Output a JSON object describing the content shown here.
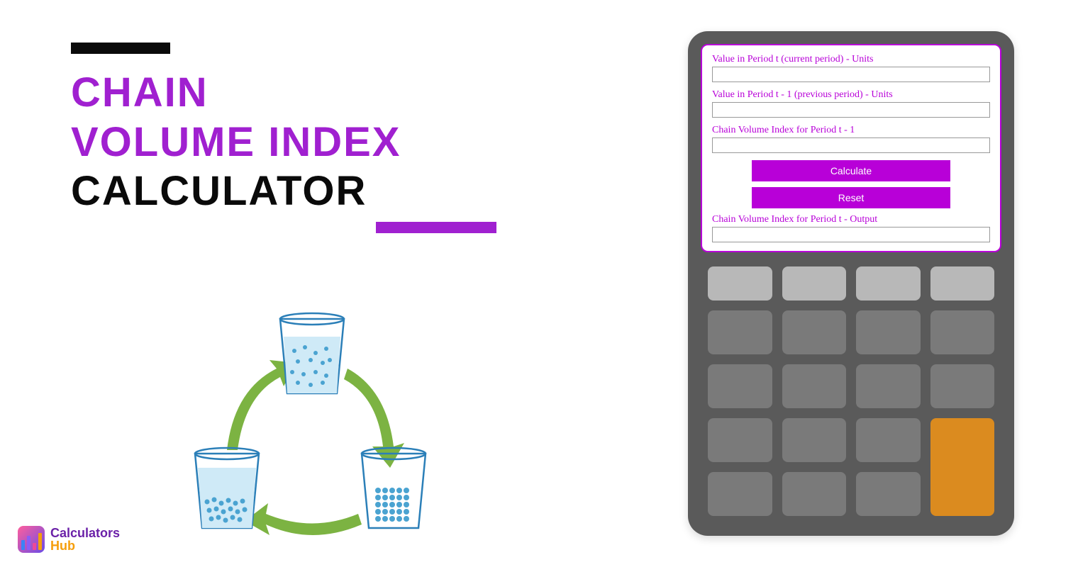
{
  "title": {
    "line1": "CHAIN",
    "line2": "VOLUME INDEX",
    "line3": "CALCULATOR"
  },
  "form": {
    "field1_label": "Value in Period t (current period) - Units",
    "field1_value": "",
    "field2_label": "Value in Period t - 1 (previous period) - Units",
    "field2_value": "",
    "field3_label": "Chain Volume Index for Period t - 1",
    "field3_value": "",
    "calculate_label": "Calculate",
    "reset_label": "Reset",
    "output_label": "Chain Volume Index for Period t - Output",
    "output_value": ""
  },
  "logo": {
    "text1": "Calculators",
    "text2": "Hub"
  },
  "colors": {
    "purple": "#a020d0",
    "magenta": "#b800d8",
    "black": "#0a0a0a",
    "calc_body": "#5a5a5a",
    "key_light": "#b8b8b8",
    "key_dark": "#7a7a7a",
    "key_orange": "#db8b1f",
    "cup_blue": "#87ceeb",
    "arrow_green": "#7cb342"
  }
}
